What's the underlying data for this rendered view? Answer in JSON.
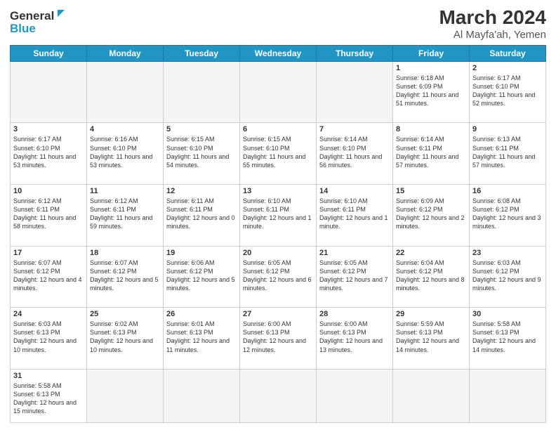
{
  "logo": {
    "text_general": "General",
    "text_blue": "Blue"
  },
  "title": "March 2024",
  "subtitle": "Al Mayfa'ah, Yemen",
  "days_of_week": [
    "Sunday",
    "Monday",
    "Tuesday",
    "Wednesday",
    "Thursday",
    "Friday",
    "Saturday"
  ],
  "weeks": [
    [
      {
        "day": "",
        "info": ""
      },
      {
        "day": "",
        "info": ""
      },
      {
        "day": "",
        "info": ""
      },
      {
        "day": "",
        "info": ""
      },
      {
        "day": "",
        "info": ""
      },
      {
        "day": "1",
        "info": "Sunrise: 6:18 AM\nSunset: 6:09 PM\nDaylight: 11 hours and 51 minutes."
      },
      {
        "day": "2",
        "info": "Sunrise: 6:17 AM\nSunset: 6:10 PM\nDaylight: 11 hours and 52 minutes."
      }
    ],
    [
      {
        "day": "3",
        "info": "Sunrise: 6:17 AM\nSunset: 6:10 PM\nDaylight: 11 hours and 53 minutes."
      },
      {
        "day": "4",
        "info": "Sunrise: 6:16 AM\nSunset: 6:10 PM\nDaylight: 11 hours and 53 minutes."
      },
      {
        "day": "5",
        "info": "Sunrise: 6:15 AM\nSunset: 6:10 PM\nDaylight: 11 hours and 54 minutes."
      },
      {
        "day": "6",
        "info": "Sunrise: 6:15 AM\nSunset: 6:10 PM\nDaylight: 11 hours and 55 minutes."
      },
      {
        "day": "7",
        "info": "Sunrise: 6:14 AM\nSunset: 6:10 PM\nDaylight: 11 hours and 56 minutes."
      },
      {
        "day": "8",
        "info": "Sunrise: 6:14 AM\nSunset: 6:11 PM\nDaylight: 11 hours and 57 minutes."
      },
      {
        "day": "9",
        "info": "Sunrise: 6:13 AM\nSunset: 6:11 PM\nDaylight: 11 hours and 57 minutes."
      }
    ],
    [
      {
        "day": "10",
        "info": "Sunrise: 6:12 AM\nSunset: 6:11 PM\nDaylight: 11 hours and 58 minutes."
      },
      {
        "day": "11",
        "info": "Sunrise: 6:12 AM\nSunset: 6:11 PM\nDaylight: 11 hours and 59 minutes."
      },
      {
        "day": "12",
        "info": "Sunrise: 6:11 AM\nSunset: 6:11 PM\nDaylight: 12 hours and 0 minutes."
      },
      {
        "day": "13",
        "info": "Sunrise: 6:10 AM\nSunset: 6:11 PM\nDaylight: 12 hours and 1 minute."
      },
      {
        "day": "14",
        "info": "Sunrise: 6:10 AM\nSunset: 6:11 PM\nDaylight: 12 hours and 1 minute."
      },
      {
        "day": "15",
        "info": "Sunrise: 6:09 AM\nSunset: 6:12 PM\nDaylight: 12 hours and 2 minutes."
      },
      {
        "day": "16",
        "info": "Sunrise: 6:08 AM\nSunset: 6:12 PM\nDaylight: 12 hours and 3 minutes."
      }
    ],
    [
      {
        "day": "17",
        "info": "Sunrise: 6:07 AM\nSunset: 6:12 PM\nDaylight: 12 hours and 4 minutes."
      },
      {
        "day": "18",
        "info": "Sunrise: 6:07 AM\nSunset: 6:12 PM\nDaylight: 12 hours and 5 minutes."
      },
      {
        "day": "19",
        "info": "Sunrise: 6:06 AM\nSunset: 6:12 PM\nDaylight: 12 hours and 5 minutes."
      },
      {
        "day": "20",
        "info": "Sunrise: 6:05 AM\nSunset: 6:12 PM\nDaylight: 12 hours and 6 minutes."
      },
      {
        "day": "21",
        "info": "Sunrise: 6:05 AM\nSunset: 6:12 PM\nDaylight: 12 hours and 7 minutes."
      },
      {
        "day": "22",
        "info": "Sunrise: 6:04 AM\nSunset: 6:12 PM\nDaylight: 12 hours and 8 minutes."
      },
      {
        "day": "23",
        "info": "Sunrise: 6:03 AM\nSunset: 6:12 PM\nDaylight: 12 hours and 9 minutes."
      }
    ],
    [
      {
        "day": "24",
        "info": "Sunrise: 6:03 AM\nSunset: 6:13 PM\nDaylight: 12 hours and 10 minutes."
      },
      {
        "day": "25",
        "info": "Sunrise: 6:02 AM\nSunset: 6:13 PM\nDaylight: 12 hours and 10 minutes."
      },
      {
        "day": "26",
        "info": "Sunrise: 6:01 AM\nSunset: 6:13 PM\nDaylight: 12 hours and 11 minutes."
      },
      {
        "day": "27",
        "info": "Sunrise: 6:00 AM\nSunset: 6:13 PM\nDaylight: 12 hours and 12 minutes."
      },
      {
        "day": "28",
        "info": "Sunrise: 6:00 AM\nSunset: 6:13 PM\nDaylight: 12 hours and 13 minutes."
      },
      {
        "day": "29",
        "info": "Sunrise: 5:59 AM\nSunset: 6:13 PM\nDaylight: 12 hours and 14 minutes."
      },
      {
        "day": "30",
        "info": "Sunrise: 5:58 AM\nSunset: 6:13 PM\nDaylight: 12 hours and 14 minutes."
      }
    ],
    [
      {
        "day": "31",
        "info": "Sunrise: 5:58 AM\nSunset: 6:13 PM\nDaylight: 12 hours and 15 minutes."
      },
      {
        "day": "",
        "info": ""
      },
      {
        "day": "",
        "info": ""
      },
      {
        "day": "",
        "info": ""
      },
      {
        "day": "",
        "info": ""
      },
      {
        "day": "",
        "info": ""
      },
      {
        "day": "",
        "info": ""
      }
    ]
  ]
}
